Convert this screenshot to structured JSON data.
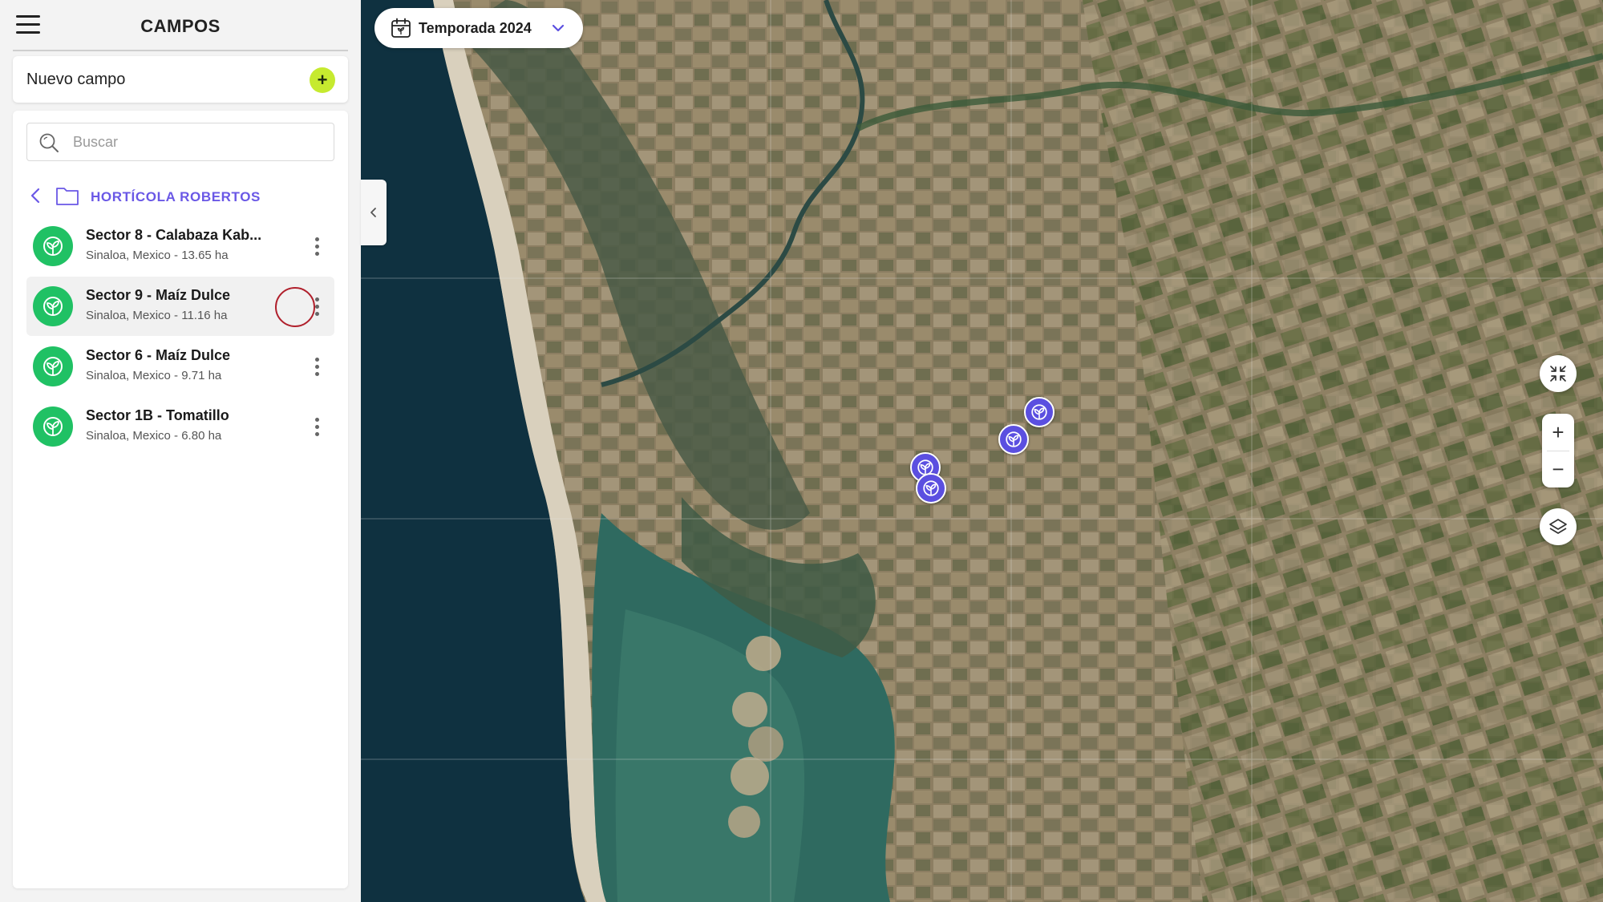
{
  "sidebar": {
    "title": "CAMPOS",
    "new_field_label": "Nuevo campo",
    "add_button_glyph": "+",
    "search": {
      "placeholder": "Buscar",
      "value": ""
    },
    "group": {
      "name": "HORTÍCOLA ROBERTOS"
    },
    "fields": [
      {
        "name": "Sector 8 - Calabaza Kab...",
        "location": "Sinaloa, Mexico - 13.65 ha",
        "selected": false
      },
      {
        "name": "Sector 9 - Maíz Dulce",
        "location": "Sinaloa, Mexico - 11.16 ha",
        "selected": true
      },
      {
        "name": "Sector 6 - Maíz Dulce",
        "location": "Sinaloa, Mexico - 9.71 ha",
        "selected": false
      },
      {
        "name": "Sector 1B - Tomatillo",
        "location": "Sinaloa, Mexico - 6.80 ha",
        "selected": false
      }
    ]
  },
  "map": {
    "season_label": "Temporada 2024",
    "zoom_in_glyph": "+",
    "zoom_out_glyph": "−",
    "marker_count": 4,
    "icons": {
      "season": "calendar-icon",
      "dropdown": "chevron-down-icon",
      "fullscreen": "collapse-arrows-icon",
      "layers": "layers-icon",
      "marker": "plant-icon"
    }
  },
  "colors": {
    "accent": "#6a58e6",
    "field_avatar": "#20c164",
    "add_button": "#c6ea2f",
    "marker": "#5b4fe0",
    "selection_ring": "#b0202c"
  }
}
